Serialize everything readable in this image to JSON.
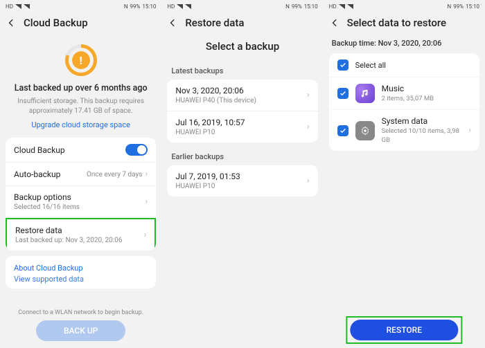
{
  "status": {
    "hd_label": "HD",
    "nfc": "N",
    "battery_pct": "99%",
    "time": "15:10"
  },
  "screen1": {
    "title": "Cloud Backup",
    "hero_title": "Last backed up over 6 months ago",
    "hero_sub": "Insufficient storage. This backup requires approximately 17.41 GB of space.",
    "upgrade_link": "Upgrade cloud storage space",
    "cloud_backup_label": "Cloud Backup",
    "auto_backup_label": "Auto-backup",
    "auto_backup_value": "Once every 7 days",
    "backup_options_label": "Backup options",
    "backup_options_sub": "Selected 16/16 items",
    "restore_label": "Restore data",
    "restore_sub": "Last backed up: Nov 3, 2020, 20:06",
    "about_link": "About Cloud Backup",
    "supported_link": "View supported data",
    "footer_note": "Connect to a WLAN network to begin backup.",
    "backup_btn": "BACK UP"
  },
  "screen2": {
    "title": "Restore data",
    "subtitle": "Select a backup",
    "section_latest": "Latest backups",
    "section_earlier": "Earlier backups",
    "backups": [
      {
        "date": "Nov 3, 2020, 20:06",
        "device": "HUAWEI P40 (This device)"
      },
      {
        "date": "Jul 16, 2019, 10:57",
        "device": "HUAWEI P10"
      }
    ],
    "earlier": [
      {
        "date": "Jul 7, 2019, 01:53",
        "device": "HUAWEI P10"
      }
    ]
  },
  "screen3": {
    "title": "Select data to restore",
    "backup_time": "Backup time: Nov 3, 2020, 20:06",
    "select_all": "Select all",
    "items": [
      {
        "name": "Music",
        "sub": "2 items, 35,07 MB"
      },
      {
        "name": "System data",
        "sub": "Selected 10/10 items, 3,98 GB"
      }
    ],
    "restore_btn": "RESTORE"
  }
}
